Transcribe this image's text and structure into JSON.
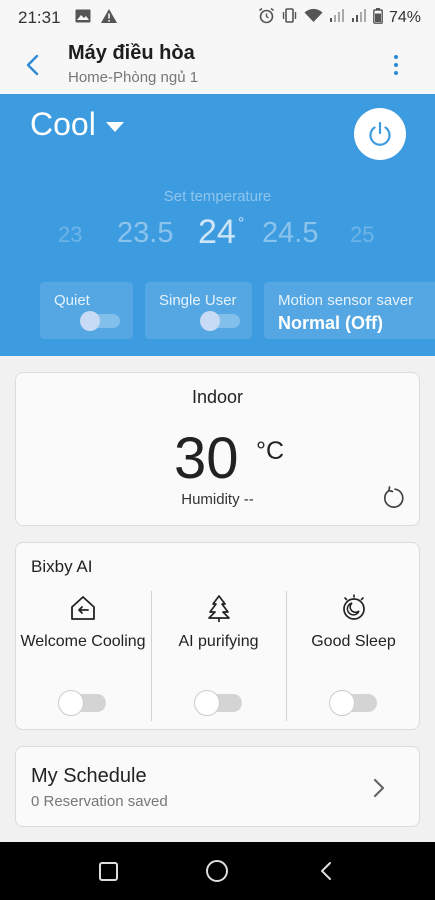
{
  "status_bar": {
    "time": "21:31",
    "battery": "74%",
    "left_icons": [
      "image-icon",
      "alert-icon"
    ],
    "right_icons": [
      "alarm-icon",
      "vibrate-icon",
      "wifi-icon",
      "signal-icon",
      "signal-icon",
      "battery-icon"
    ]
  },
  "app_bar": {
    "title": "Máy điều hòa",
    "subtitle": "Home-Phòng ngủ 1"
  },
  "control": {
    "mode": "Cool",
    "set_temperature_label": "Set temperature",
    "temperatures": [
      "23",
      "23.5",
      "24",
      "24.5",
      "25"
    ],
    "selected_temperature": "24",
    "degree_symbol": "°",
    "accent_color": "#3d9be0",
    "options": {
      "quiet": {
        "label": "Quiet",
        "on": false
      },
      "single_user": {
        "label": "Single User",
        "on": false
      },
      "motion_sensor": {
        "label": "Motion sensor saver",
        "value": "Normal (Off)"
      }
    }
  },
  "indoor": {
    "title": "Indoor",
    "temperature": "30",
    "unit": "°C",
    "humidity": "Humidity --"
  },
  "bixby": {
    "title": "Bixby AI",
    "items": [
      {
        "label": "Welcome Cooling",
        "icon": "home-return-icon",
        "on": false
      },
      {
        "label": "AI purifying",
        "icon": "tree-icon",
        "on": false
      },
      {
        "label": "Good Sleep",
        "icon": "sleep-moon-icon",
        "on": false
      }
    ]
  },
  "schedule": {
    "title": "My Schedule",
    "subtitle": "0 Reservation saved"
  }
}
